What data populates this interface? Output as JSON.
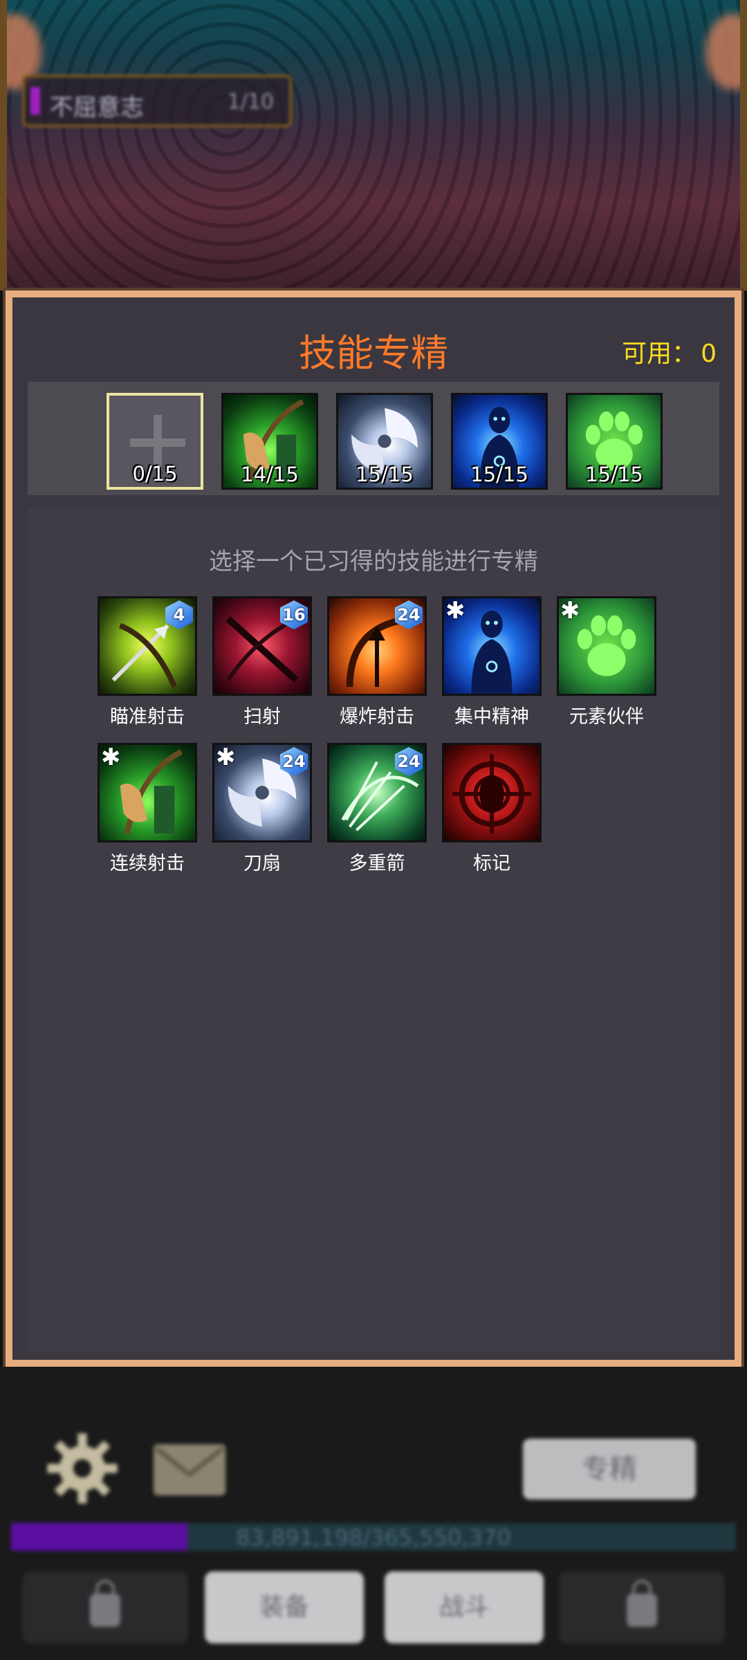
{
  "stage": {
    "name": "不屈意志",
    "progress": "1/10"
  },
  "panel": {
    "title": "技能专精",
    "available_label": "可用：",
    "available_value": "0",
    "slots": [
      {
        "label": "0/15",
        "icon": "empty-plus"
      },
      {
        "label": "14/15",
        "icon": "green-bow-archer"
      },
      {
        "label": "15/15",
        "icon": "spinning-axe"
      },
      {
        "label": "15/15",
        "icon": "blue-spirit-figure"
      },
      {
        "label": "15/15",
        "icon": "green-paw"
      }
    ],
    "instruction": "选择一个已习得的技能进行专精",
    "skills": [
      {
        "name": "瞄准射击",
        "badge": "4",
        "starred": false,
        "icon": "aimed-arrow"
      },
      {
        "name": "扫射",
        "badge": "16",
        "starred": false,
        "icon": "crossbow-strafe"
      },
      {
        "name": "爆炸射击",
        "badge": "24",
        "starred": false,
        "icon": "explosive-arrow"
      },
      {
        "name": "集中精神",
        "badge": "",
        "starred": true,
        "icon": "blue-spirit-figure"
      },
      {
        "name": "元素伙伴",
        "badge": "",
        "starred": true,
        "icon": "green-paw"
      },
      {
        "name": "连续射击",
        "badge": "",
        "starred": true,
        "icon": "green-bow-archer"
      },
      {
        "name": "刀扇",
        "badge": "24",
        "starred": true,
        "icon": "spinning-axe"
      },
      {
        "name": "多重箭",
        "badge": "24",
        "starred": false,
        "icon": "multi-arrow-bow"
      },
      {
        "name": "标记",
        "badge": "",
        "starred": false,
        "icon": "red-target-mark"
      }
    ],
    "star_symbol": "✱"
  },
  "bottom": {
    "spec_button": "专精",
    "xp_text": "83,891,198/365,550,370",
    "xp_fraction": 0.243,
    "nav_equip": "装备",
    "nav_battle": "战斗"
  },
  "colors": {
    "title": "#ff7a2a",
    "available": "#ffdc1e",
    "panel_border": "#e7ae80",
    "badge": "#1a5fd8"
  }
}
